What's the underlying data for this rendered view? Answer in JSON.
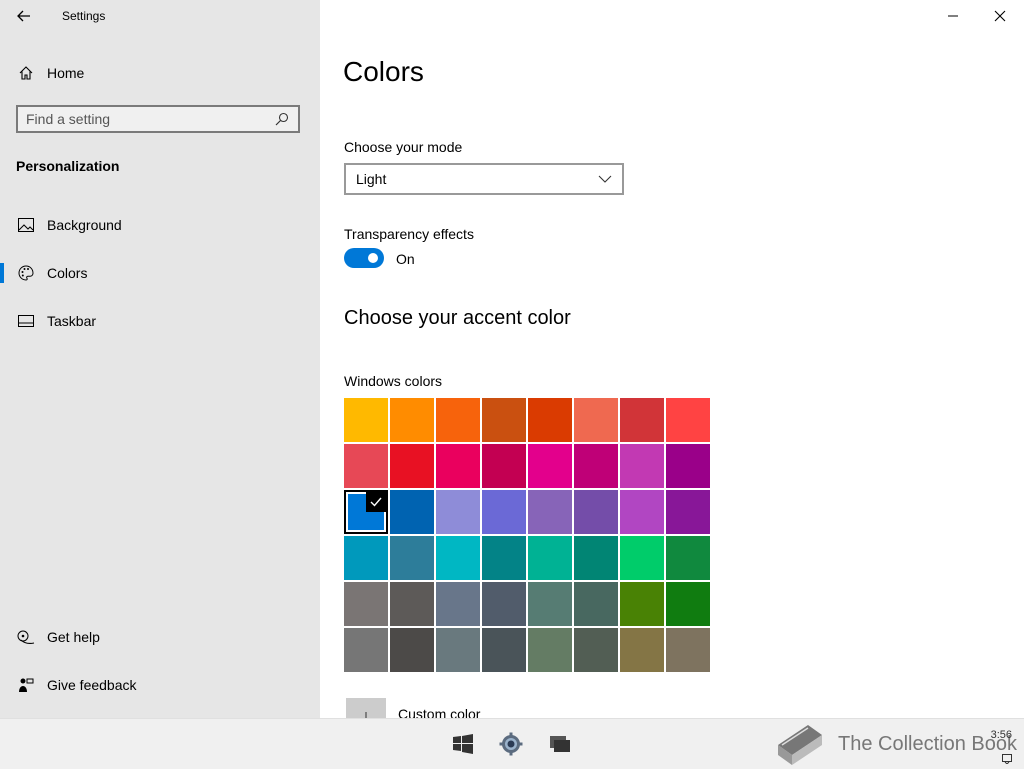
{
  "app": {
    "title": "Settings"
  },
  "sidebar": {
    "home_label": "Home",
    "search_placeholder": "Find a setting",
    "section": "Personalization",
    "items": [
      {
        "label": "Background",
        "icon": "image-icon"
      },
      {
        "label": "Colors",
        "icon": "palette-icon",
        "selected": true
      },
      {
        "label": "Taskbar",
        "icon": "taskbar-icon"
      }
    ],
    "footer": [
      {
        "label": "Get help",
        "icon": "help-icon"
      },
      {
        "label": "Give feedback",
        "icon": "feedback-icon"
      }
    ]
  },
  "main": {
    "title": "Colors",
    "mode_label": "Choose your mode",
    "mode_value": "Light",
    "transparency_label": "Transparency effects",
    "transparency_state": "On",
    "accent_heading": "Choose your accent color",
    "windows_colors_label": "Windows colors",
    "swatches": [
      "#ffb900",
      "#ff8c00",
      "#f7630c",
      "#ca5010",
      "#da3b01",
      "#ef6950",
      "#d13438",
      "#ff4343",
      "#e74856",
      "#e81123",
      "#ea005e",
      "#c30052",
      "#e3008c",
      "#bf0077",
      "#c239b3",
      "#9a0089",
      "#0078d7",
      "#0063b1",
      "#8e8cd8",
      "#6b69d6",
      "#8764b8",
      "#744da9",
      "#b146c2",
      "#881798",
      "#0099bc",
      "#2d7d9a",
      "#00b7c3",
      "#038387",
      "#00b294",
      "#018574",
      "#00cc6a",
      "#10893e",
      "#7a7574",
      "#5d5a58",
      "#68768a",
      "#515c6b",
      "#567c73",
      "#486860",
      "#498205",
      "#107c10",
      "#767676",
      "#4c4a48",
      "#69797e",
      "#4a5459",
      "#647c64",
      "#525e54",
      "#847545",
      "#7e735f"
    ],
    "selected_swatch_index": 16,
    "custom_color_label": "Custom color"
  },
  "taskbar": {
    "clock": "3:56",
    "watermark": "The Collection Book"
  },
  "colors": {
    "accent": "#0078d7",
    "sidebar_bg": "#e6e6e6"
  }
}
